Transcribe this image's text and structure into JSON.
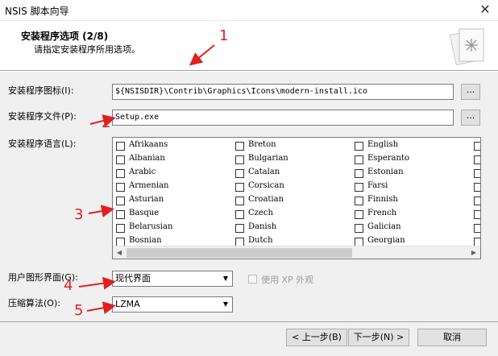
{
  "window": {
    "title": "NSIS 脚本向导",
    "close_icon": "close-icon"
  },
  "header": {
    "title": "安装程序选项 (2/8)",
    "subtitle": "请指定安装程序所用选项。",
    "logo_icon": "installer-book-icon"
  },
  "fields": {
    "icon_label": "安装程序图标(I):",
    "icon_value": "${NSISDIR}\\Contrib\\Graphics\\Icons\\modern-install.ico",
    "file_label": "安装程序文件(P):",
    "file_value": "Setup.exe",
    "browse_label": "...",
    "language_label": "安装程序语言(L):",
    "ui_label": "用户图形界面(G):",
    "ui_value": "现代界面",
    "xp_label": "使用 XP 外观",
    "compress_label": "压缩算法(O):",
    "compress_value": "LZMA"
  },
  "languages": [
    [
      "Afrikaans",
      "Albanian",
      "Arabic",
      "Armenian",
      "Asturian",
      "Basque",
      "Belarusian",
      "Bosnian"
    ],
    [
      "Breton",
      "Bulgarian",
      "Catalan",
      "Corsican",
      "Croatian",
      "Czech",
      "Danish",
      "Dutch"
    ],
    [
      "English",
      "Esperanto",
      "Estonian",
      "Farsi",
      "Finnish",
      "French",
      "Galician",
      "Georgian"
    ]
  ],
  "footer": {
    "back": "< 上一步(B)",
    "next": "下一步(N) >",
    "cancel": "取消"
  },
  "annotations": [
    "1",
    "2",
    "3",
    "4",
    "5"
  ],
  "annotation_color": "#e02020"
}
